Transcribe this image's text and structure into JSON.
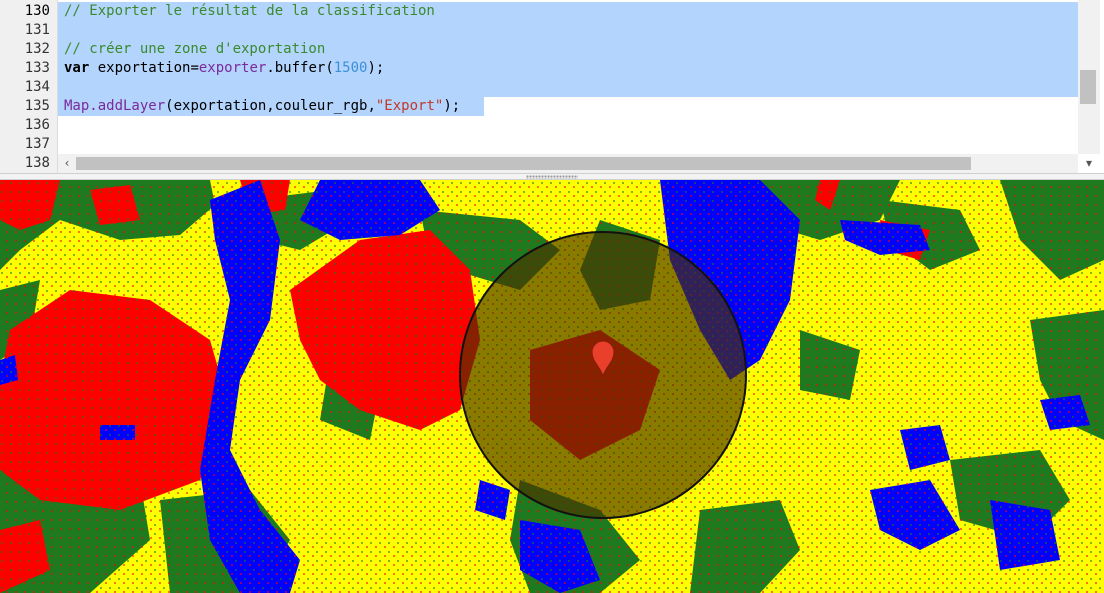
{
  "editor": {
    "lines": [
      {
        "number": "130",
        "tokens": [
          {
            "t": "// Exporter le résultat de la classification",
            "c": "cm"
          }
        ]
      },
      {
        "number": "131",
        "tokens": []
      },
      {
        "number": "132",
        "tokens": [
          {
            "t": "// créer une zone d'exportation",
            "c": "cm"
          }
        ]
      },
      {
        "number": "133",
        "tokens": [
          {
            "t": "var",
            "c": "kw"
          },
          {
            "t": " exportation=",
            "c": ""
          },
          {
            "t": "exporter",
            "c": "fn"
          },
          {
            "t": ".buffer(",
            "c": ""
          },
          {
            "t": "1500",
            "c": "num"
          },
          {
            "t": ");",
            "c": ""
          }
        ]
      },
      {
        "number": "134",
        "tokens": []
      },
      {
        "number": "135",
        "tokens": [
          {
            "t": "Map.addLayer",
            "c": "fn"
          },
          {
            "t": "(exportation,couleur_rgb,",
            "c": ""
          },
          {
            "t": "\"Export\"",
            "c": "str"
          },
          {
            "t": ");",
            "c": ""
          }
        ]
      },
      {
        "number": "136",
        "tokens": []
      },
      {
        "number": "137",
        "tokens": []
      },
      {
        "number": "138",
        "tokens": []
      }
    ],
    "selection_color": "#b3d4fc"
  },
  "map": {
    "layer_colors": {
      "background": "#ffff00",
      "urban": "#ff0000",
      "water": "#0000ff",
      "vegetation": "#1f7a1f"
    },
    "buffer_fill": "#4a3200",
    "buffer_opacity": 0.65,
    "marker_color": "#e8402a"
  },
  "icons": {
    "scroll_down": "▾",
    "scroll_left": "‹"
  }
}
